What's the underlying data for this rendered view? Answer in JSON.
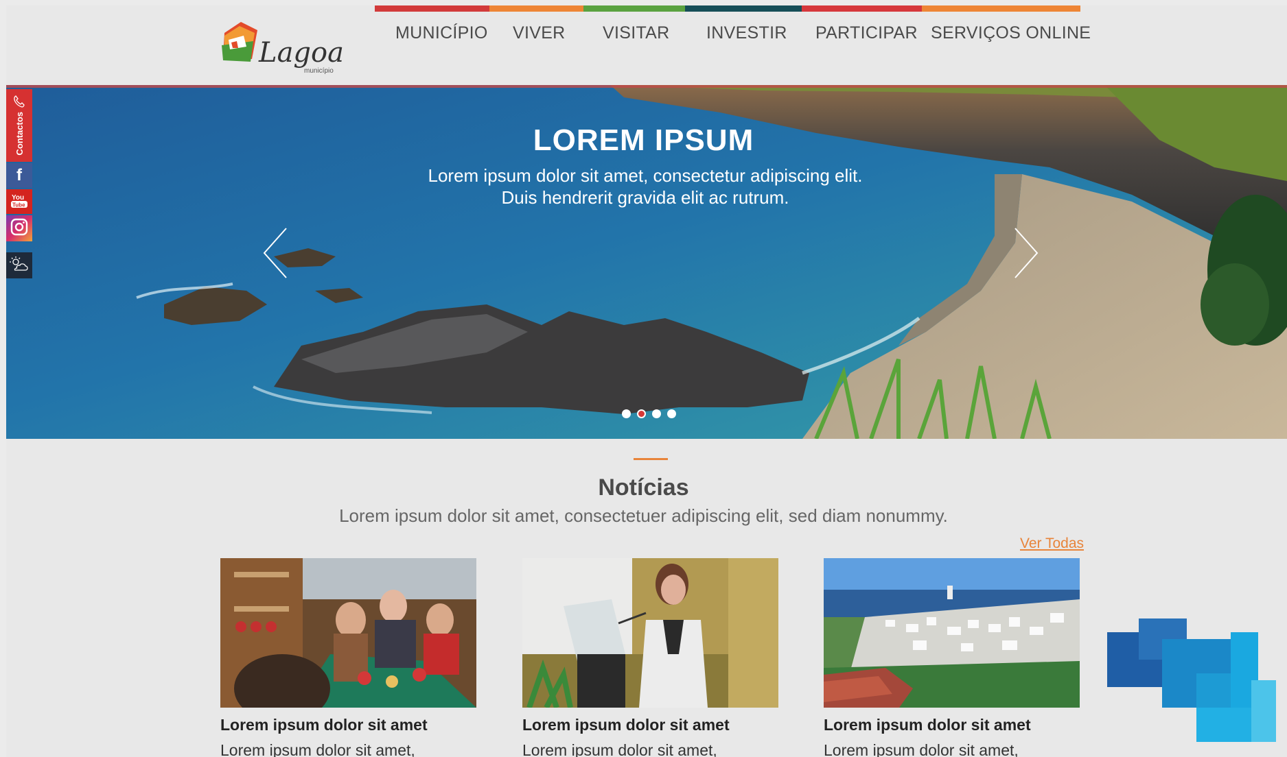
{
  "header": {
    "logo_text": "Lagoa",
    "logo_subtext": "município",
    "nav": [
      {
        "label": "MUNICÍPIO",
        "color": "#d23a3a"
      },
      {
        "label": "VIVER",
        "color": "#ee8536"
      },
      {
        "label": "VISITAR",
        "color": "#5aa240"
      },
      {
        "label": "INVESTIR",
        "color": "#164e57"
      },
      {
        "label": "PARTICIPAR",
        "color": "#d6383c"
      },
      {
        "label": "SERVIÇOS ONLINE",
        "color": "#ee8536"
      }
    ]
  },
  "sidebar": {
    "contactos_label": "Contactos",
    "items": [
      {
        "icon": "phone-icon",
        "color": "#d63131"
      },
      {
        "icon": "facebook-icon",
        "color": "#3c5a98"
      },
      {
        "icon": "youtube-icon",
        "color": "#d4241f"
      },
      {
        "icon": "instagram-icon",
        "color": "#b3328f"
      },
      {
        "icon": "weather-icon",
        "color": "#1e2a3a"
      }
    ]
  },
  "hero": {
    "title": "LOREM IPSUM",
    "text": "Lorem ipsum dolor sit amet, consectetur adipiscing elit. Duis hendrerit gravida elit ac rutrum.",
    "slides_total": 4,
    "active_slide": 2
  },
  "news": {
    "title": "Notícias",
    "subtitle": "Lorem ipsum dolor sit amet, consectetuer adipiscing elit, sed diam nonummy.",
    "see_all": "Ver Todas",
    "accent": "#e8843a",
    "cards": [
      {
        "title": "Lorem ipsum dolor sit amet",
        "text": "Lorem ipsum dolor sit amet,"
      },
      {
        "title": "Lorem ipsum dolor sit amet",
        "text": "Lorem ipsum dolor sit amet,"
      },
      {
        "title": "Lorem ipsum dolor sit amet",
        "text": "Lorem ipsum dolor sit amet,"
      }
    ]
  }
}
